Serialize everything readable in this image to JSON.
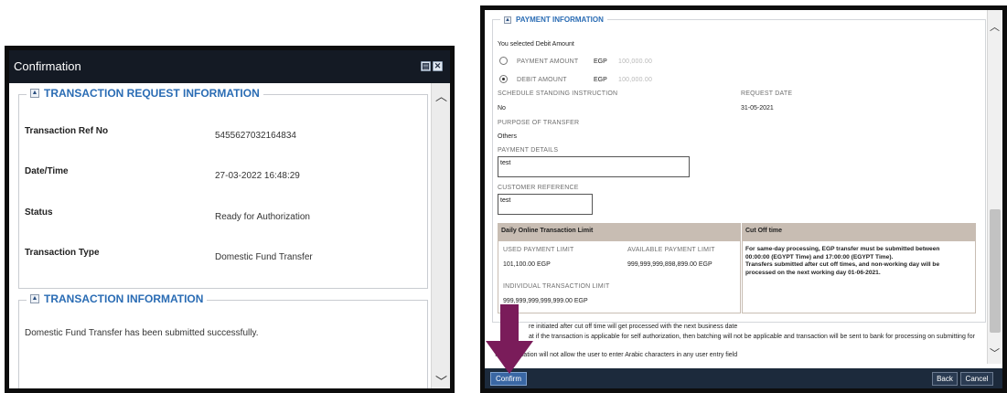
{
  "left_window": {
    "title": "Confirmation",
    "section1": {
      "legend": "TRANSACTION REQUEST INFORMATION",
      "fields": [
        {
          "label": "Transaction Ref No",
          "value": "5455627032164834"
        },
        {
          "label": "Date/Time",
          "value": "27-03-2022 16:48:29"
        },
        {
          "label": "Status",
          "value": "Ready for Authorization"
        },
        {
          "label": "Transaction Type",
          "value": "Domestic Fund Transfer"
        }
      ]
    },
    "section2": {
      "legend": "TRANSACTION INFORMATION",
      "message": "Domestic Fund Transfer has been submitted successfully."
    }
  },
  "right_window": {
    "legend": "PAYMENT INFORMATION",
    "selected_text": "You selected Debit Amount",
    "payment_amount": {
      "label": "PAYMENT AMOUNT",
      "currency": "EGP",
      "value": "100,000.00"
    },
    "debit_amount": {
      "label": "DEBIT AMOUNT",
      "currency": "EGP",
      "value": "100,000.00"
    },
    "standing_instruction": {
      "label": "SCHEDULE STANDING INSTRUCTION",
      "value": "No"
    },
    "request_date": {
      "label": "REQUEST DATE",
      "value": "31-05-2021"
    },
    "purpose": {
      "label": "PURPOSE OF TRANSFER",
      "value": "Others"
    },
    "payment_details": {
      "label": "PAYMENT DETAILS",
      "value": "test"
    },
    "customer_reference": {
      "label": "CUSTOMER REFERENCE",
      "value": "test"
    },
    "limit": {
      "header": "Daily Online Transaction Limit",
      "used_label": "USED PAYMENT LIMIT",
      "used_value": "101,100.00 EGP",
      "available_label": "AVAILABLE PAYMENT LIMIT",
      "available_value": "999,999,999,898,899.00 EGP",
      "individual_label": "INDIVIDUAL TRANSACTION LIMIT",
      "individual_value": "999,999,999,999,999.00 EGP"
    },
    "cutoff": {
      "header": "Cut Off time",
      "line1": "For same-day processing, EGP transfer must be submitted between",
      "line2": "00:00:00 (EGYPT Time) and 17:00:00 (EGYPT Time).",
      "line3": "Transfers submitted after cut off times, and non-working day will be",
      "line4": "processed on the next working day 01-06-2021."
    },
    "notes": {
      "line1": "re initiated after cut off time will get processed with the next business date",
      "line2": "at if the transaction is applicable for self authorization, then batching will not be applicable and transaction will be sent to bank for processing on submitting for",
      "line3": "Be",
      "line4": "The application will not allow the user to enter Arabic characters in any user entry field"
    },
    "buttons": {
      "confirm": "Confirm",
      "back": "Back",
      "cancel": "Cancel"
    }
  },
  "colors": {
    "arrow": "#7a1c5a",
    "accent": "#2a6cb4",
    "title_bar": "#141a24"
  }
}
